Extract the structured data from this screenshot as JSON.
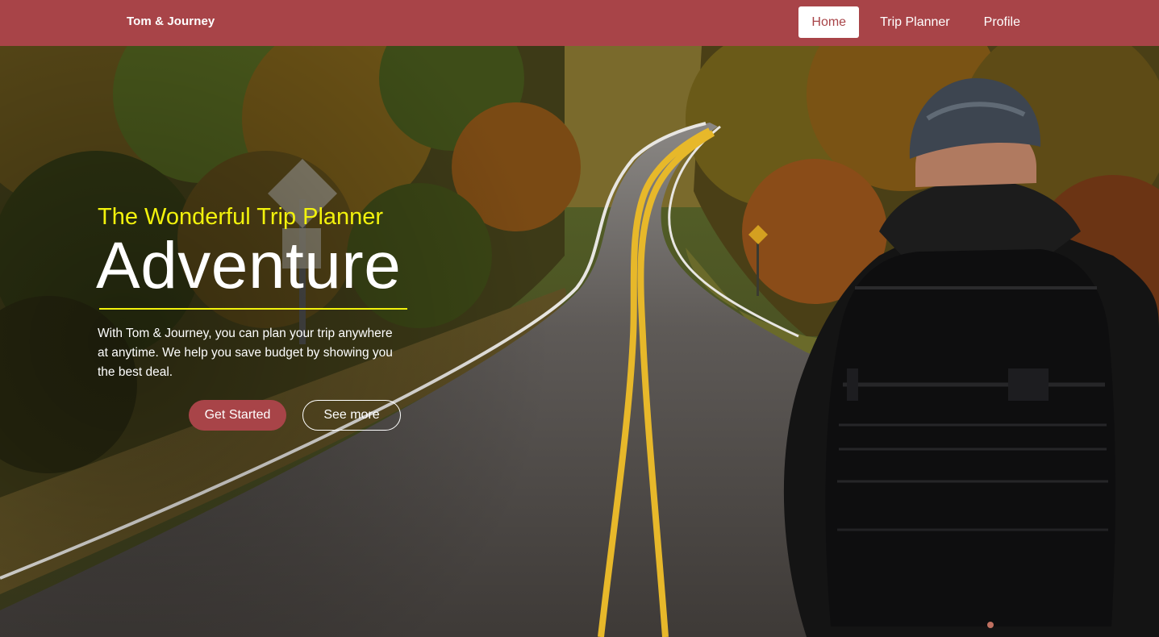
{
  "navbar": {
    "brand": "Tom & Journey",
    "links": [
      {
        "label": "Home",
        "active": true
      },
      {
        "label": "Trip Planner",
        "active": false
      },
      {
        "label": "Profile",
        "active": false
      }
    ]
  },
  "hero": {
    "subtitle": "The Wonderful Trip Planner",
    "title": "Adventure",
    "description": "With Tom & Journey, you can plan your trip anywhere at anytime. We help you save budget by showing you the best deal.",
    "primary_button": "Get Started",
    "secondary_button": "See more"
  },
  "colors": {
    "brand": "#a84448",
    "accent": "#f2f20c",
    "text_light": "#ffffff"
  }
}
